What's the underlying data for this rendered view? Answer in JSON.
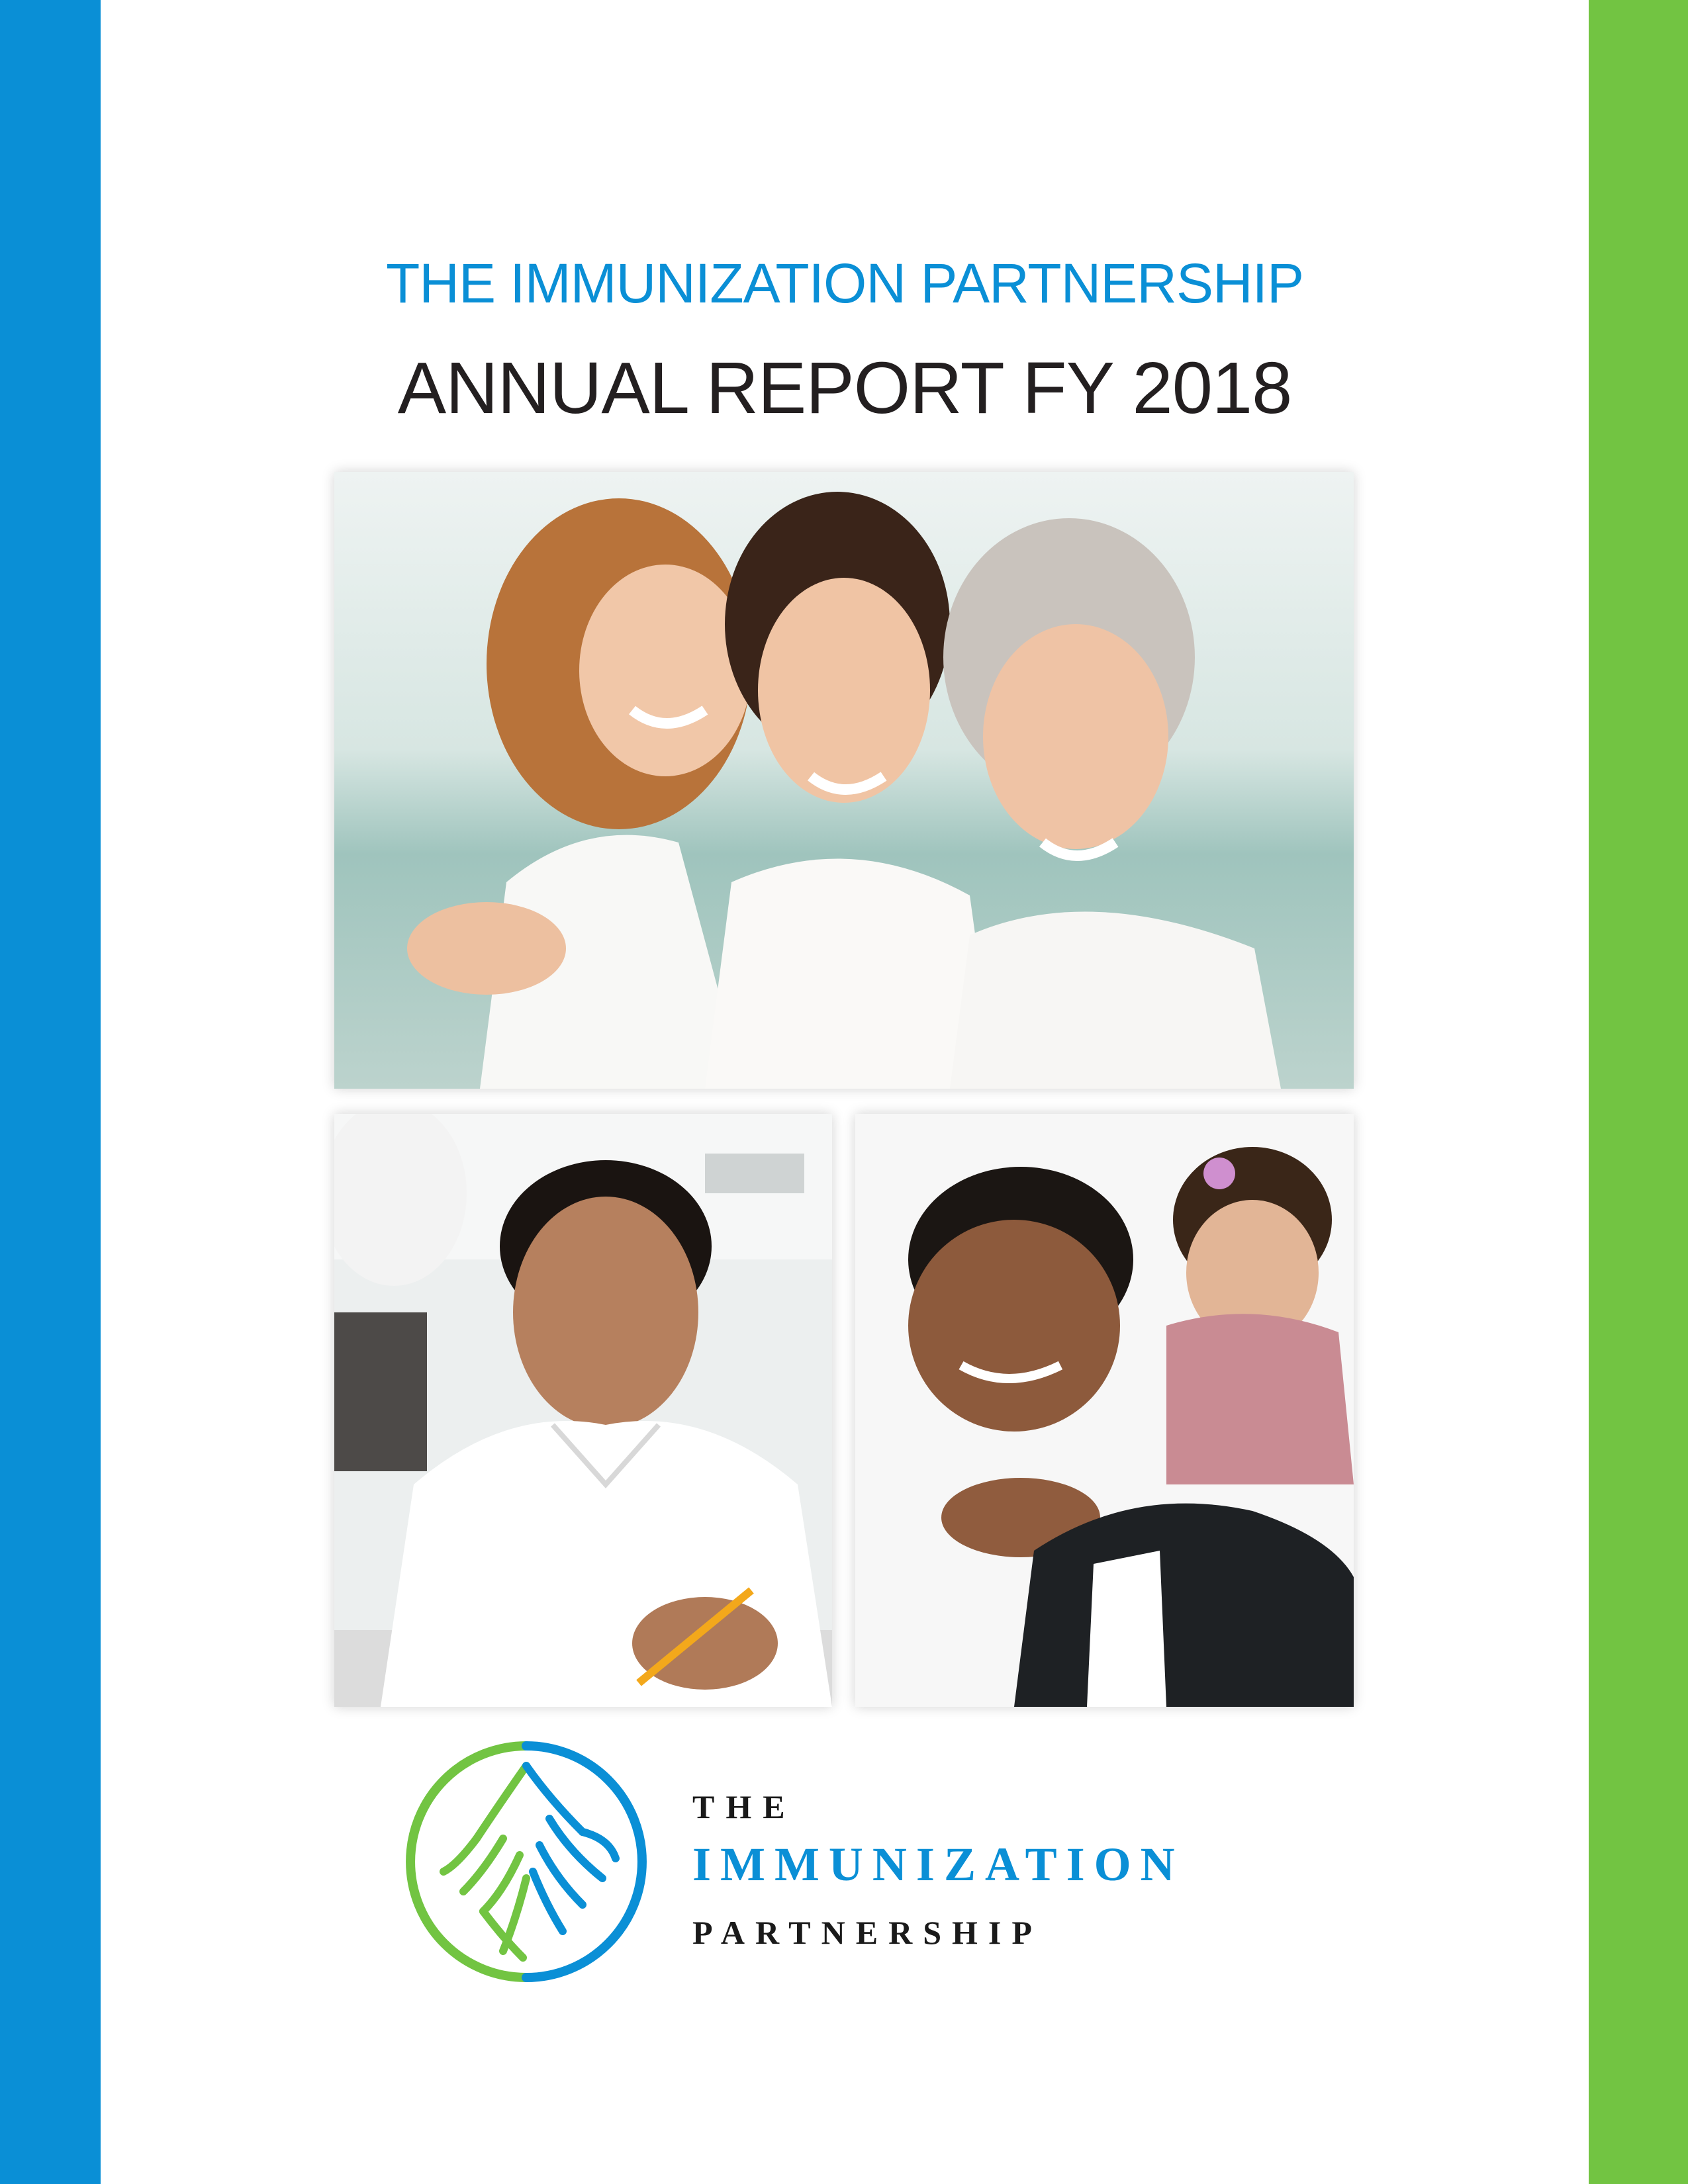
{
  "cover": {
    "org_heading": "THE IMMUNIZATION PARTNERSHIP",
    "report_title": "ANNUAL REPORT FY 2018"
  },
  "logo": {
    "line1": "THE",
    "line2": "IMMUNIZATION",
    "line3": "PARTNERSHIP",
    "icon": "hands-circle-icon"
  },
  "photos": {
    "top": "family-three-generations-photo",
    "bottom_left": "teen-student-photo",
    "bottom_right": "mother-and-child-photo"
  },
  "colors": {
    "blue": "#0a8fd6",
    "green": "#72c442",
    "dark_text": "#231f20",
    "logo_dark": "#1a1a1a"
  }
}
